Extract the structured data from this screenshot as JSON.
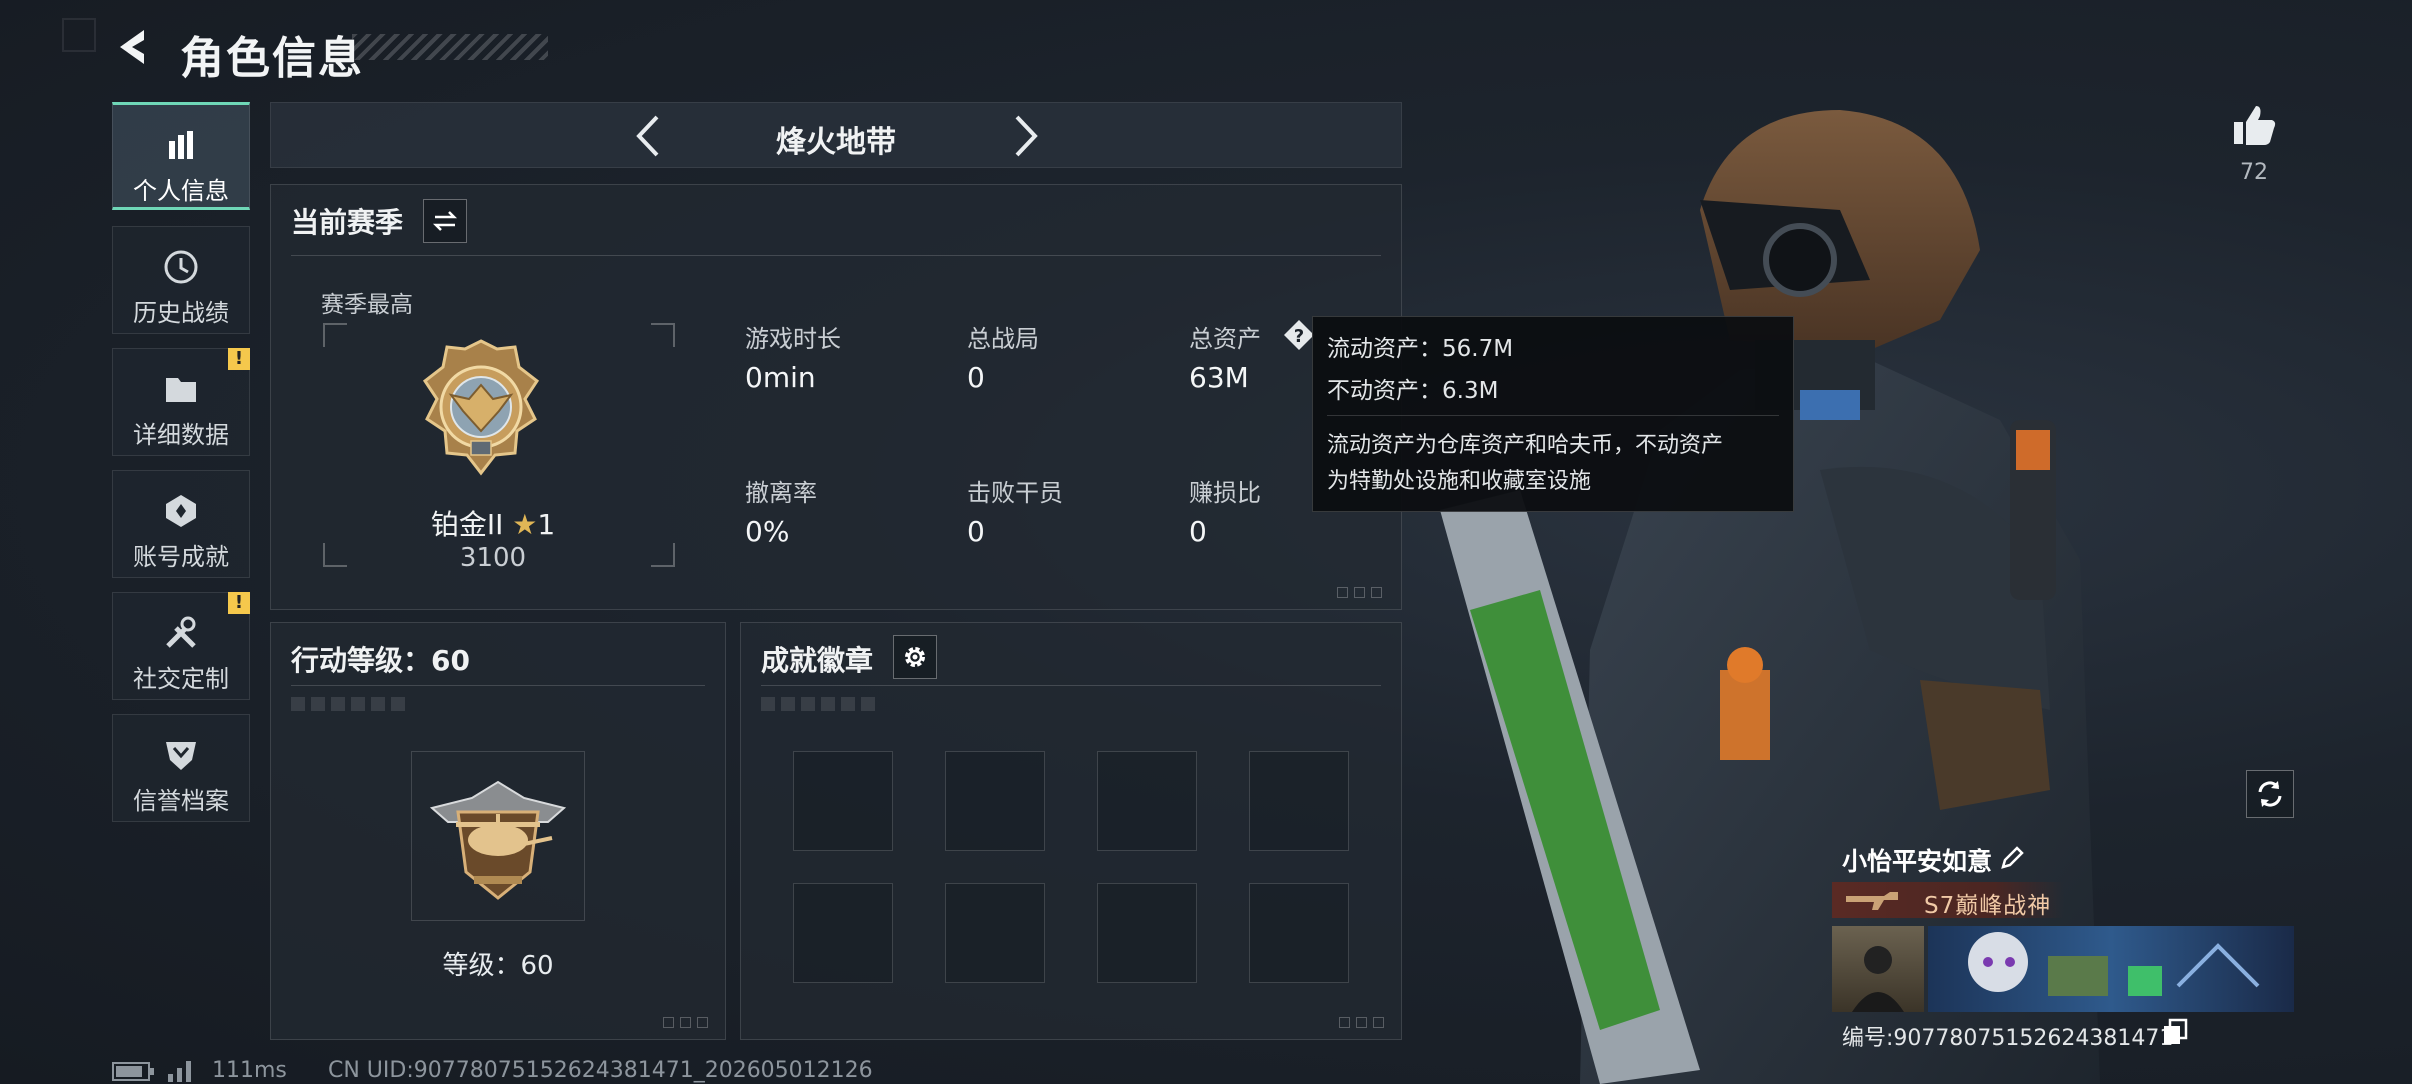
{
  "header": {
    "title": "角色信息"
  },
  "sidebar": {
    "items": [
      {
        "label": "个人信息",
        "icon": "bar-chart-icon",
        "active": true
      },
      {
        "label": "历史战绩",
        "icon": "history-icon"
      },
      {
        "label": "详细数据",
        "icon": "folder-icon",
        "badge": "!"
      },
      {
        "label": "账号成就",
        "icon": "achievement-icon"
      },
      {
        "label": "社交定制",
        "icon": "tools-icon",
        "badge": "!"
      },
      {
        "label": "信誉档案",
        "icon": "credit-shield-icon"
      }
    ]
  },
  "mode": {
    "title": "烽火地带"
  },
  "season": {
    "title": "当前赛季",
    "best_label": "赛季最高",
    "rank_name": "铂金II",
    "rank_stars": "1",
    "rank_points": "3100",
    "stats": [
      {
        "label": "游戏时长",
        "value": "0min"
      },
      {
        "label": "总战局",
        "value": "0"
      },
      {
        "label": "总资产",
        "value": "63M"
      },
      {
        "label": "撤离率",
        "value": "0%"
      },
      {
        "label": "击败干员",
        "value": "0"
      },
      {
        "label": "赚损比",
        "value": "0"
      }
    ]
  },
  "tooltip": {
    "line1": "流动资产：56.7M",
    "line2": "不动资产：6.3M",
    "desc1": "流动资产为仓库资产和哈夫币，不动资产",
    "desc2": "为特勤处设施和收藏室设施"
  },
  "action_level": {
    "title": "行动等级：60",
    "level_text": "等级：60"
  },
  "achievement_badges": {
    "title": "成就徽章",
    "slots": 8
  },
  "likes": {
    "count": "72"
  },
  "player": {
    "name": "小怡平安如意",
    "title": "S7巅峰战神",
    "id_text": "编号:9077807515262438147​1"
  },
  "footer": {
    "ping": "111ms",
    "uid": "CN UID:9077807515262438147​1_202605012126"
  },
  "colors": {
    "accent": "#6fd7b7",
    "warning": "#f5c84c",
    "rank_gold": "#c9a35a"
  }
}
